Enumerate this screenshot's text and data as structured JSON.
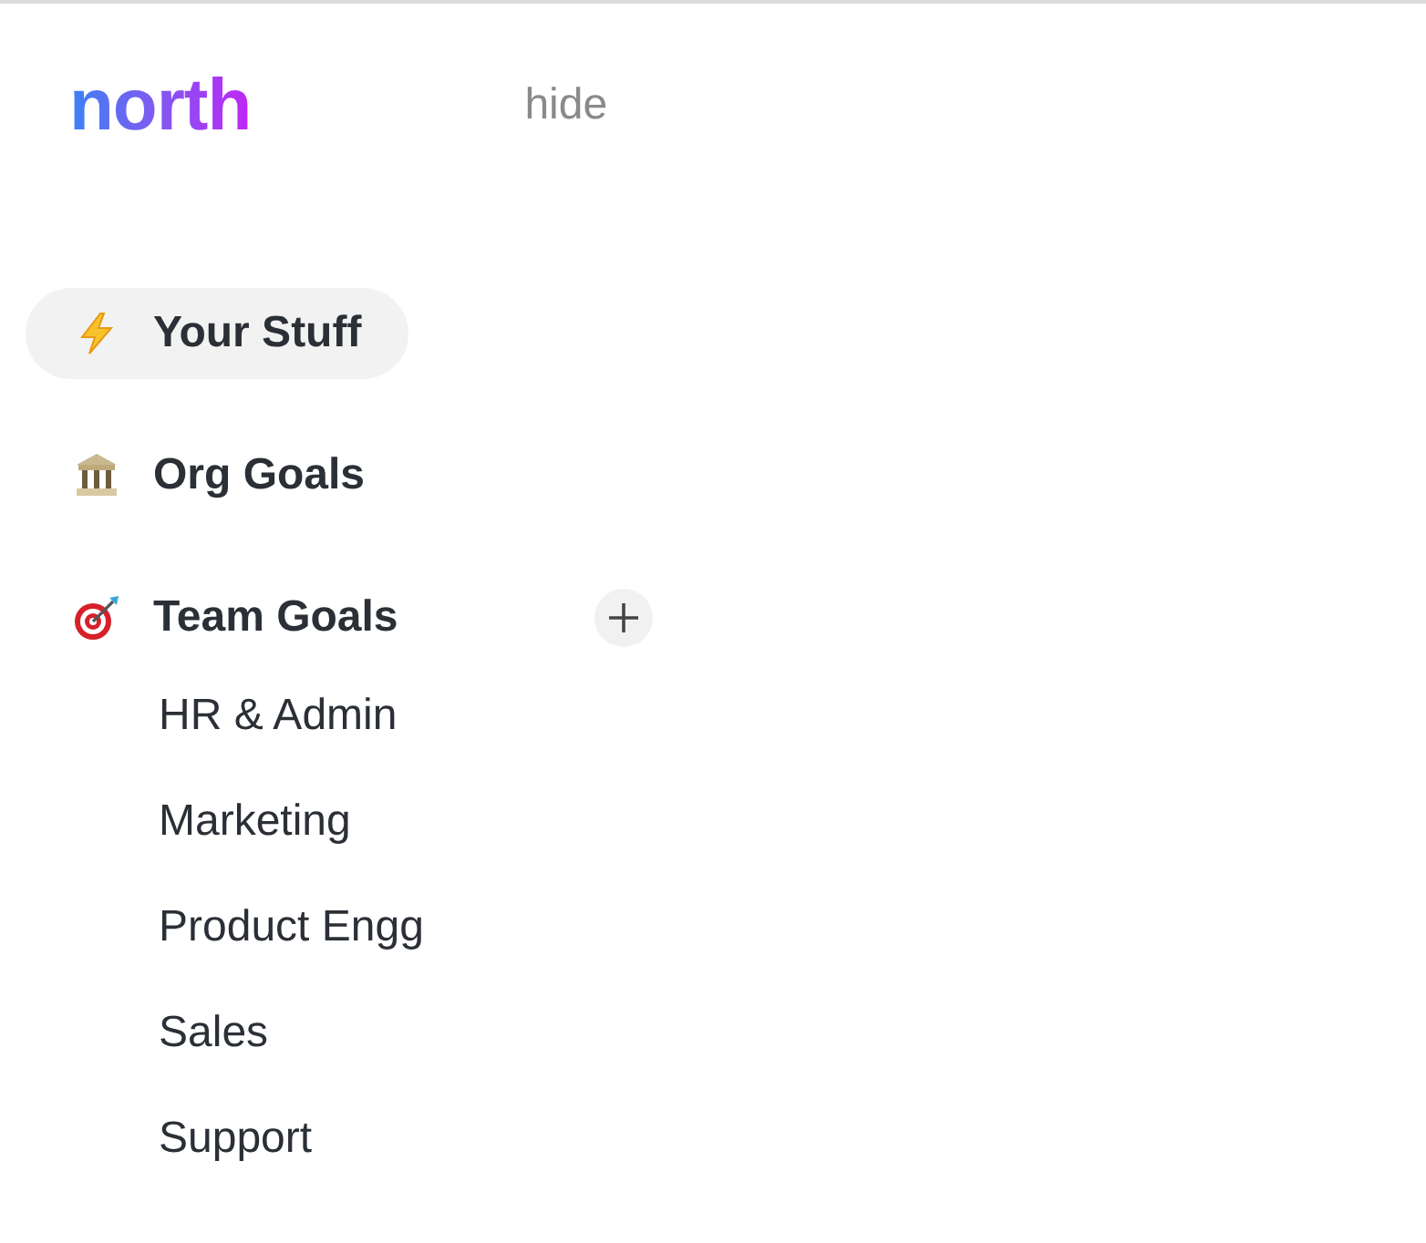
{
  "logo": "north",
  "hide_link": "hide",
  "nav": [
    {
      "label": "Your Stuff",
      "kind": "bolt",
      "selected": true
    },
    {
      "label": "Org Goals",
      "kind": "bank",
      "selected": false
    },
    {
      "label": "Team Goals",
      "kind": "target",
      "selected": false,
      "add_button": true,
      "children": [
        {
          "label": "HR & Admin"
        },
        {
          "label": "Marketing"
        },
        {
          "label": "Product Engg"
        },
        {
          "label": "Sales"
        },
        {
          "label": "Support"
        }
      ]
    }
  ]
}
